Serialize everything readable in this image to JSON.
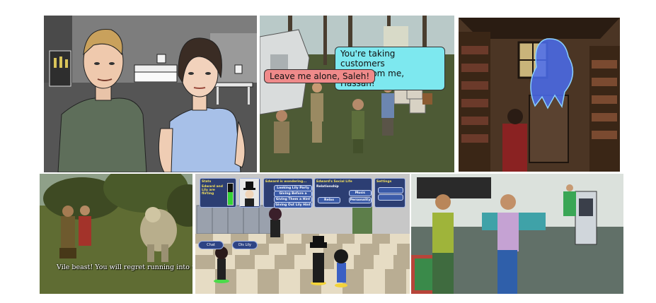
{
  "panel2": {
    "speech_right": "You're taking customers\naway from me, Hassan!",
    "speech_left": "Leave me alone, Saleh!"
  },
  "panel4": {
    "subtitle": "Vile beast! You will regret running into us this day!"
  },
  "panel5": {
    "stats_title": "Stats",
    "stats_line": "Edward and Lily are flirting",
    "mood_title": "Edward is wondering...",
    "mood_options": [
      "Looking Lily Party",
      "Giving Before a Shell Hint",
      "Giving Them a Hint",
      "Giving Out Lily Hint"
    ],
    "social_title": "Edward's Social Life",
    "social_sub": "Relationship",
    "social_btn_a": "Music",
    "social_btn_b": "Personality",
    "social_btn_c": "Relax",
    "settings_title": "Settings",
    "pill_left": "Chat",
    "pill_right": "Dis Lily"
  },
  "colors": {
    "bubble_cyan": "#7de8ef",
    "bubble_pink": "#ef8a8a",
    "ui_blue": "#2c3e73",
    "ui_text": "#f5e15a"
  }
}
